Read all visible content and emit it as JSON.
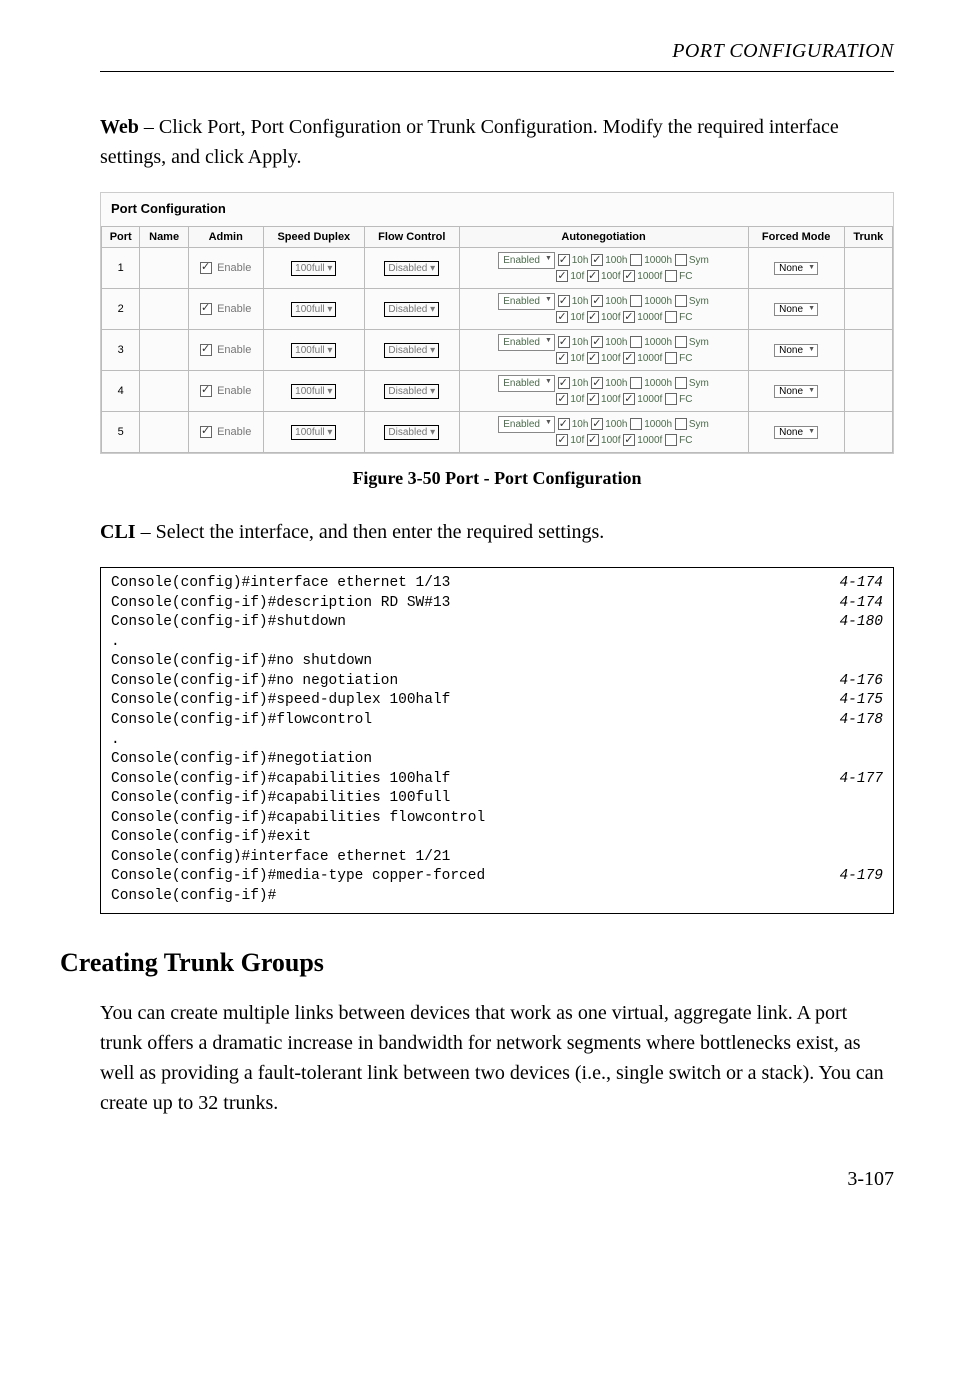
{
  "header": {
    "title": "PORT CONFIGURATION"
  },
  "intro": {
    "lead": "Web",
    "rest": " – Click Port, Port Configuration or Trunk Configuration. Modify the required interface settings, and click Apply."
  },
  "figure": {
    "caption": "Figure 3-50  Port - Port Configuration"
  },
  "port_config": {
    "title": "Port Configuration",
    "headers": {
      "port": "Port",
      "name": "Name",
      "admin": "Admin",
      "speed": "Speed Duplex",
      "flow": "Flow Control",
      "autoneg": "Autonegotiation",
      "forced": "Forced Mode",
      "trunk": "Trunk"
    },
    "rows": [
      {
        "port": "1"
      },
      {
        "port": "2"
      },
      {
        "port": "3"
      },
      {
        "port": "4"
      },
      {
        "port": "5"
      }
    ],
    "common": {
      "admin_label": "Enable",
      "speed_value": "100full",
      "flow_value": "Disabled",
      "autoneg_value": "Enabled",
      "forced_value": "None",
      "caps": {
        "r1": [
          {
            "label": "10h",
            "on": true
          },
          {
            "label": "100h",
            "on": true
          },
          {
            "label": "1000h",
            "on": false
          },
          {
            "label": "Sym",
            "on": false
          }
        ],
        "r2": [
          {
            "label": "10f",
            "on": true
          },
          {
            "label": "100f",
            "on": true
          },
          {
            "label": "1000f",
            "on": true
          },
          {
            "label": "FC",
            "on": false
          }
        ]
      }
    }
  },
  "cli_intro": {
    "lead": "CLI",
    "rest": " – Select the interface, and then enter the required settings."
  },
  "cli": [
    {
      "cmd": "Console(config)#interface ethernet 1/13",
      "ref": "4-174"
    },
    {
      "cmd": "Console(config-if)#description RD SW#13",
      "ref": "4-174"
    },
    {
      "cmd": "Console(config-if)#shutdown",
      "ref": "4-180"
    },
    {
      "cmd": ".",
      "ref": ""
    },
    {
      "cmd": "Console(config-if)#no shutdown",
      "ref": ""
    },
    {
      "cmd": "Console(config-if)#no negotiation",
      "ref": "4-176"
    },
    {
      "cmd": "Console(config-if)#speed-duplex 100half",
      "ref": "4-175"
    },
    {
      "cmd": "Console(config-if)#flowcontrol",
      "ref": "4-178"
    },
    {
      "cmd": ".",
      "ref": ""
    },
    {
      "cmd": "Console(config-if)#negotiation",
      "ref": ""
    },
    {
      "cmd": "Console(config-if)#capabilities 100half",
      "ref": "4-177"
    },
    {
      "cmd": "Console(config-if)#capabilities 100full",
      "ref": ""
    },
    {
      "cmd": "Console(config-if)#capabilities flowcontrol",
      "ref": ""
    },
    {
      "cmd": "Console(config-if)#exit",
      "ref": ""
    },
    {
      "cmd": "Console(config)#interface ethernet 1/21",
      "ref": ""
    },
    {
      "cmd": "Console(config-if)#media-type copper-forced",
      "ref": "4-179"
    },
    {
      "cmd": "Console(config-if)#",
      "ref": ""
    }
  ],
  "section": {
    "heading": "Creating Trunk Groups",
    "body": "You can create multiple links between devices that work as one virtual, aggregate link. A port trunk offers a dramatic increase in bandwidth for network segments where bottlenecks exist, as well as providing a fault-tolerant link between two devices (i.e., single switch or a stack). You can create up to 32 trunks."
  },
  "page_number": "3-107"
}
